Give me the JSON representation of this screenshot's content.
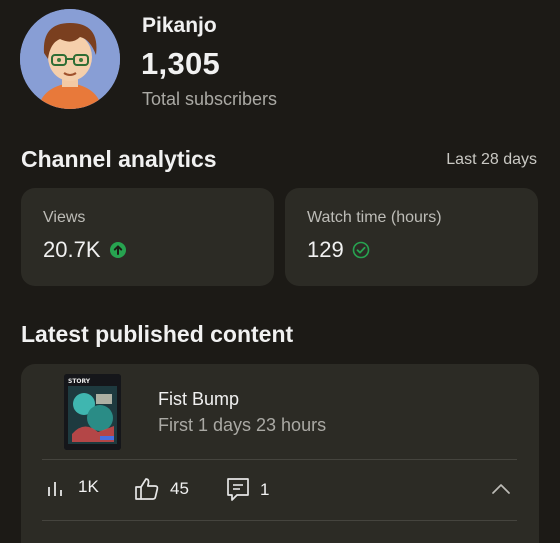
{
  "channel": {
    "name": "Pikanjo",
    "subscriber_count": "1,305",
    "subscriber_label": "Total subscribers"
  },
  "analytics": {
    "title": "Channel analytics",
    "range_label": "Last 28 days",
    "views": {
      "label": "Views",
      "value": "20.7K",
      "status_icon": "arrow-up-circle-icon",
      "status_color": "#27a350"
    },
    "watch_time": {
      "label": "Watch time (hours)",
      "value": "129",
      "status_icon": "check-circle-icon",
      "status_color": "#27a350"
    }
  },
  "latest": {
    "title": "Latest published content",
    "video": {
      "title": "Fist Bump",
      "subtitle": "First 1 days 23 hours",
      "thumbnail_text": "STORY",
      "views": "1K",
      "likes": "45",
      "comments": "1"
    }
  },
  "colors": {
    "background": "#1c1a16",
    "card": "#2c2b25",
    "accent_green": "#27a350"
  }
}
